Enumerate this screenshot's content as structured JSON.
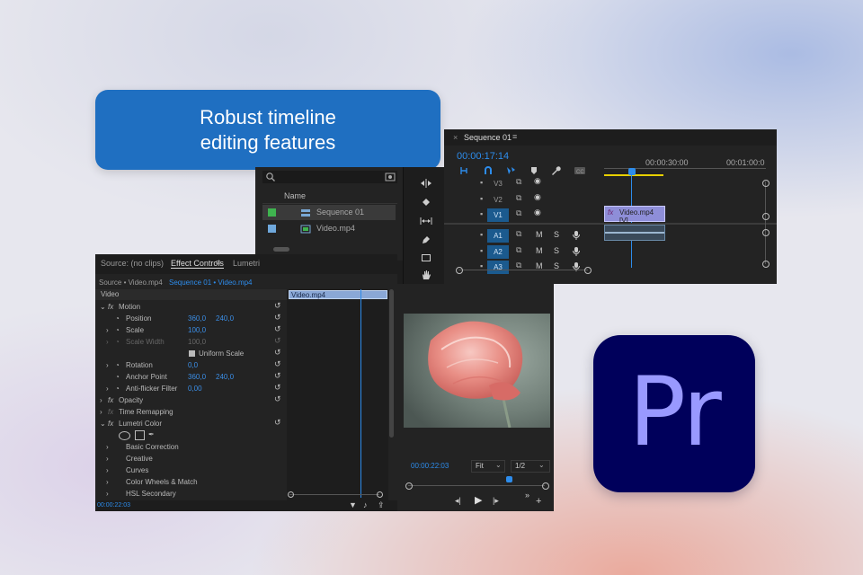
{
  "callout": {
    "line1": "Robust timeline",
    "line2": "editing features"
  },
  "project": {
    "name_header": "Name",
    "items": [
      {
        "label": "Sequence 01",
        "color": "#3fb34f"
      },
      {
        "label": "Video.mp4",
        "color": "#6fa8dc"
      }
    ]
  },
  "timeline": {
    "tab_label": "Sequence 01",
    "timecode": "00:00:17:14",
    "ruler": [
      "00:00:30:00",
      "00:01:00:0"
    ],
    "video_tracks": [
      "V3",
      "V2",
      "V1"
    ],
    "audio_tracks": [
      "A1",
      "A2",
      "A3"
    ],
    "clip_label": "Video.mp4 [V]",
    "fx_badge": "fx",
    "mute_label": "M",
    "solo_label": "S"
  },
  "effect_controls": {
    "tabs": [
      "Source: (no clips)",
      "Effect Controls",
      "Lumetri"
    ],
    "source_label": "Source • Video.mp4",
    "sequence_label": "Sequence 01 • Video.mp4",
    "section_video": "Video",
    "clip_bar": "Video.mp4",
    "motion": "Motion",
    "position": {
      "label": "Position",
      "x": "360,0",
      "y": "240,0"
    },
    "scale": {
      "label": "Scale",
      "value": "100,0"
    },
    "scale_width": {
      "label": "Scale Width",
      "value": "100,0"
    },
    "uniform_scale": "Uniform Scale",
    "rotation": {
      "label": "Rotation",
      "value": "0,0"
    },
    "anchor": {
      "label": "Anchor Point",
      "x": "360,0",
      "y": "240,0"
    },
    "anti_flicker": {
      "label": "Anti-flicker Filter",
      "value": "0,00"
    },
    "opacity": "Opacity",
    "time_remap": "Time Remapping",
    "lumetri": "Lumetri Color",
    "lumetri_items": [
      "Basic Correction",
      "Creative",
      "Curves",
      "Color Wheels & Match",
      "HSL Secondary"
    ],
    "timecode": "00:00:22:03"
  },
  "program": {
    "timecode": "00:00:22:03",
    "fit": "Fit",
    "resolution": "1/2"
  },
  "logo": {
    "text": "Pr",
    "bg": "#00005b",
    "fg": "#9999ff"
  }
}
